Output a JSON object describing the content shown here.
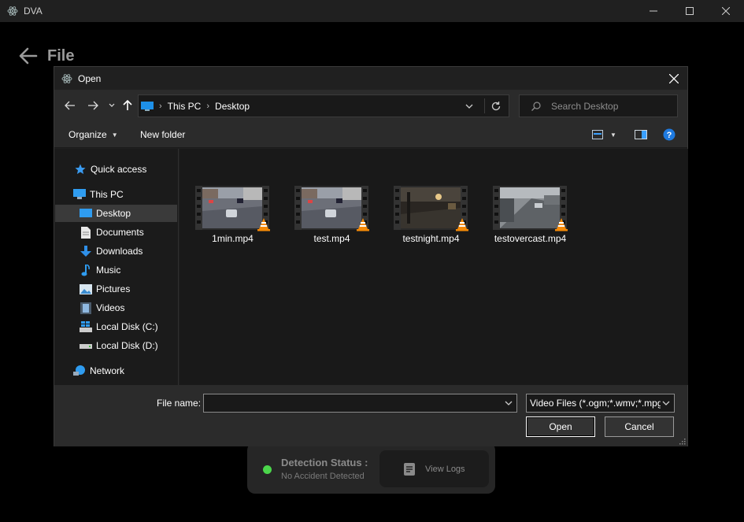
{
  "app": {
    "title": "DVA",
    "page_title": "File"
  },
  "status": {
    "title": "Detection Status :",
    "value": "No Accident Detected",
    "indicator_color": "#4bd64b",
    "view_logs_label": "View Logs"
  },
  "dialog": {
    "title": "Open",
    "breadcrumb": [
      "This PC",
      "Desktop"
    ],
    "search_placeholder": "Search Desktop",
    "toolbar": {
      "organize_label": "Organize",
      "new_folder_label": "New folder"
    },
    "nav_items": [
      {
        "label": "Quick access",
        "icon": "star-icon"
      },
      {
        "label": "This PC",
        "icon": "computer-icon"
      },
      {
        "label": "Desktop",
        "icon": "desktop-icon",
        "selected": true
      },
      {
        "label": "Documents",
        "icon": "documents-icon"
      },
      {
        "label": "Downloads",
        "icon": "download-icon"
      },
      {
        "label": "Music",
        "icon": "music-icon"
      },
      {
        "label": "Pictures",
        "icon": "pictures-icon"
      },
      {
        "label": "Videos",
        "icon": "videos-icon"
      },
      {
        "label": "Local Disk (C:)",
        "icon": "drive-c-icon"
      },
      {
        "label": "Local Disk (D:)",
        "icon": "drive-d-icon"
      },
      {
        "label": "Network",
        "icon": "network-icon"
      }
    ],
    "files": [
      {
        "name": "1min.mp4"
      },
      {
        "name": "test.mp4"
      },
      {
        "name": "testnight.mp4"
      },
      {
        "name": "testovercast.mp4"
      }
    ],
    "footer": {
      "file_name_label": "File name:",
      "file_name_value": "",
      "filter_value": "Video Files (*.ogm;*.wmv;*.mpg",
      "open_label": "Open",
      "cancel_label": "Cancel"
    }
  }
}
